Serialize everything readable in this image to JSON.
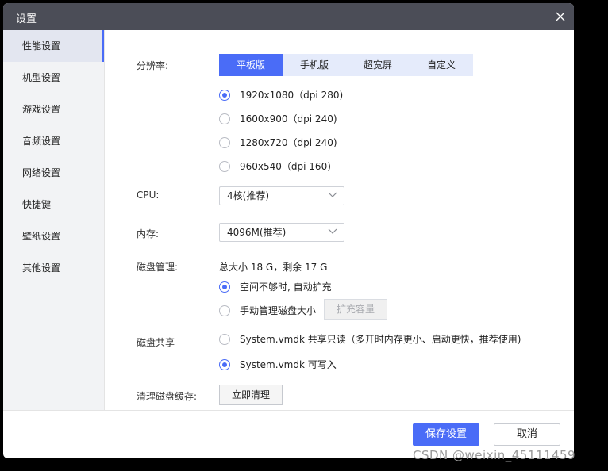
{
  "window": {
    "title": "设置"
  },
  "sidebar": {
    "items": [
      {
        "label": "性能设置"
      },
      {
        "label": "机型设置"
      },
      {
        "label": "游戏设置"
      },
      {
        "label": "音频设置"
      },
      {
        "label": "网络设置"
      },
      {
        "label": "快捷键"
      },
      {
        "label": "壁纸设置"
      },
      {
        "label": "其他设置"
      }
    ],
    "active_index": 0
  },
  "resolution": {
    "label": "分辨率:",
    "tabs": [
      "平板版",
      "手机版",
      "超宽屏",
      "自定义"
    ],
    "active_tab": 0,
    "options": [
      {
        "label": "1920x1080（dpi 280)",
        "selected": true
      },
      {
        "label": "1600x900（dpi 240)",
        "selected": false
      },
      {
        "label": "1280x720（dpi 240)",
        "selected": false
      },
      {
        "label": "960x540（dpi 160)",
        "selected": false
      }
    ]
  },
  "cpu": {
    "label": "CPU:",
    "value": "4核(推荐)"
  },
  "memory": {
    "label": "内存:",
    "value": "4096M(推荐)"
  },
  "disk": {
    "label": "磁盘管理:",
    "summary": "总大小 18 G，剩余 17 G",
    "options": [
      {
        "label": "空间不够时, 自动扩充",
        "selected": true
      },
      {
        "label": "手动管理磁盘大小",
        "selected": false
      }
    ],
    "expand_button": "扩充容量"
  },
  "share": {
    "label": "磁盘共享",
    "options": [
      {
        "label": "System.vmdk 共享只读（多开时内存更小、启动更快，推荐使用)",
        "selected": false
      },
      {
        "label": "System.vmdk 可写入",
        "selected": true
      }
    ]
  },
  "cache": {
    "label": "清理磁盘缓存:",
    "button": "立即清理"
  },
  "footer": {
    "save": "保存设置",
    "cancel": "取消"
  },
  "watermark": "CSDN @weixin_45111459",
  "colors": {
    "accent": "#4a6cf7",
    "titlebar": "#4b4d57",
    "sidebar": "#f2f3f5"
  }
}
